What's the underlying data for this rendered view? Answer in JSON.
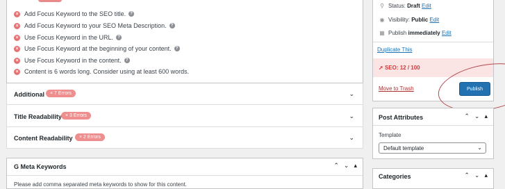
{
  "seo_checks": [
    "Add Focus Keyword to the SEO title.",
    "Add Focus Keyword to your SEO Meta Description.",
    "Use Focus Keyword in the URL.",
    "Use Focus Keyword at the beginning of your content.",
    "Use Focus Keyword in the content.",
    "Content is 6 words long. Consider using at least 600 words."
  ],
  "accordions": [
    {
      "label": "Additional",
      "badge": "× 7 Errors"
    },
    {
      "label": "Title Readability",
      "badge": "× 3 Errors"
    },
    {
      "label": "Content Readability",
      "badge": "× 2 Errors"
    }
  ],
  "meta_keywords": {
    "title": "G Meta Keywords",
    "description": "Please add comma separated meta keywords to show for this content."
  },
  "publish": {
    "status_label": "Status:",
    "status_value": "Draft",
    "visibility_label": "Visibility:",
    "visibility_value": "Public",
    "publish_label": "Publish",
    "publish_value": "immediately",
    "edit": "Edit",
    "duplicate": "Duplicate This",
    "seo_score": "SEO: 12 / 100",
    "trash": "Move to Trash",
    "publish_button": "Publish"
  },
  "post_attributes": {
    "title": "Post Attributes",
    "template_label": "Template",
    "template_value": "Default template"
  },
  "categories": {
    "title": "Categories"
  },
  "colors": {
    "error": "#e57373",
    "primary": "#2271b1",
    "seo_bg": "#fbe4e4"
  },
  "icons": [
    "x-circle-icon",
    "help-icon",
    "chevron-down-icon",
    "chevron-up-icon",
    "triangle-up-icon",
    "pin-icon",
    "eye-icon",
    "calendar-icon",
    "seo-icon"
  ]
}
